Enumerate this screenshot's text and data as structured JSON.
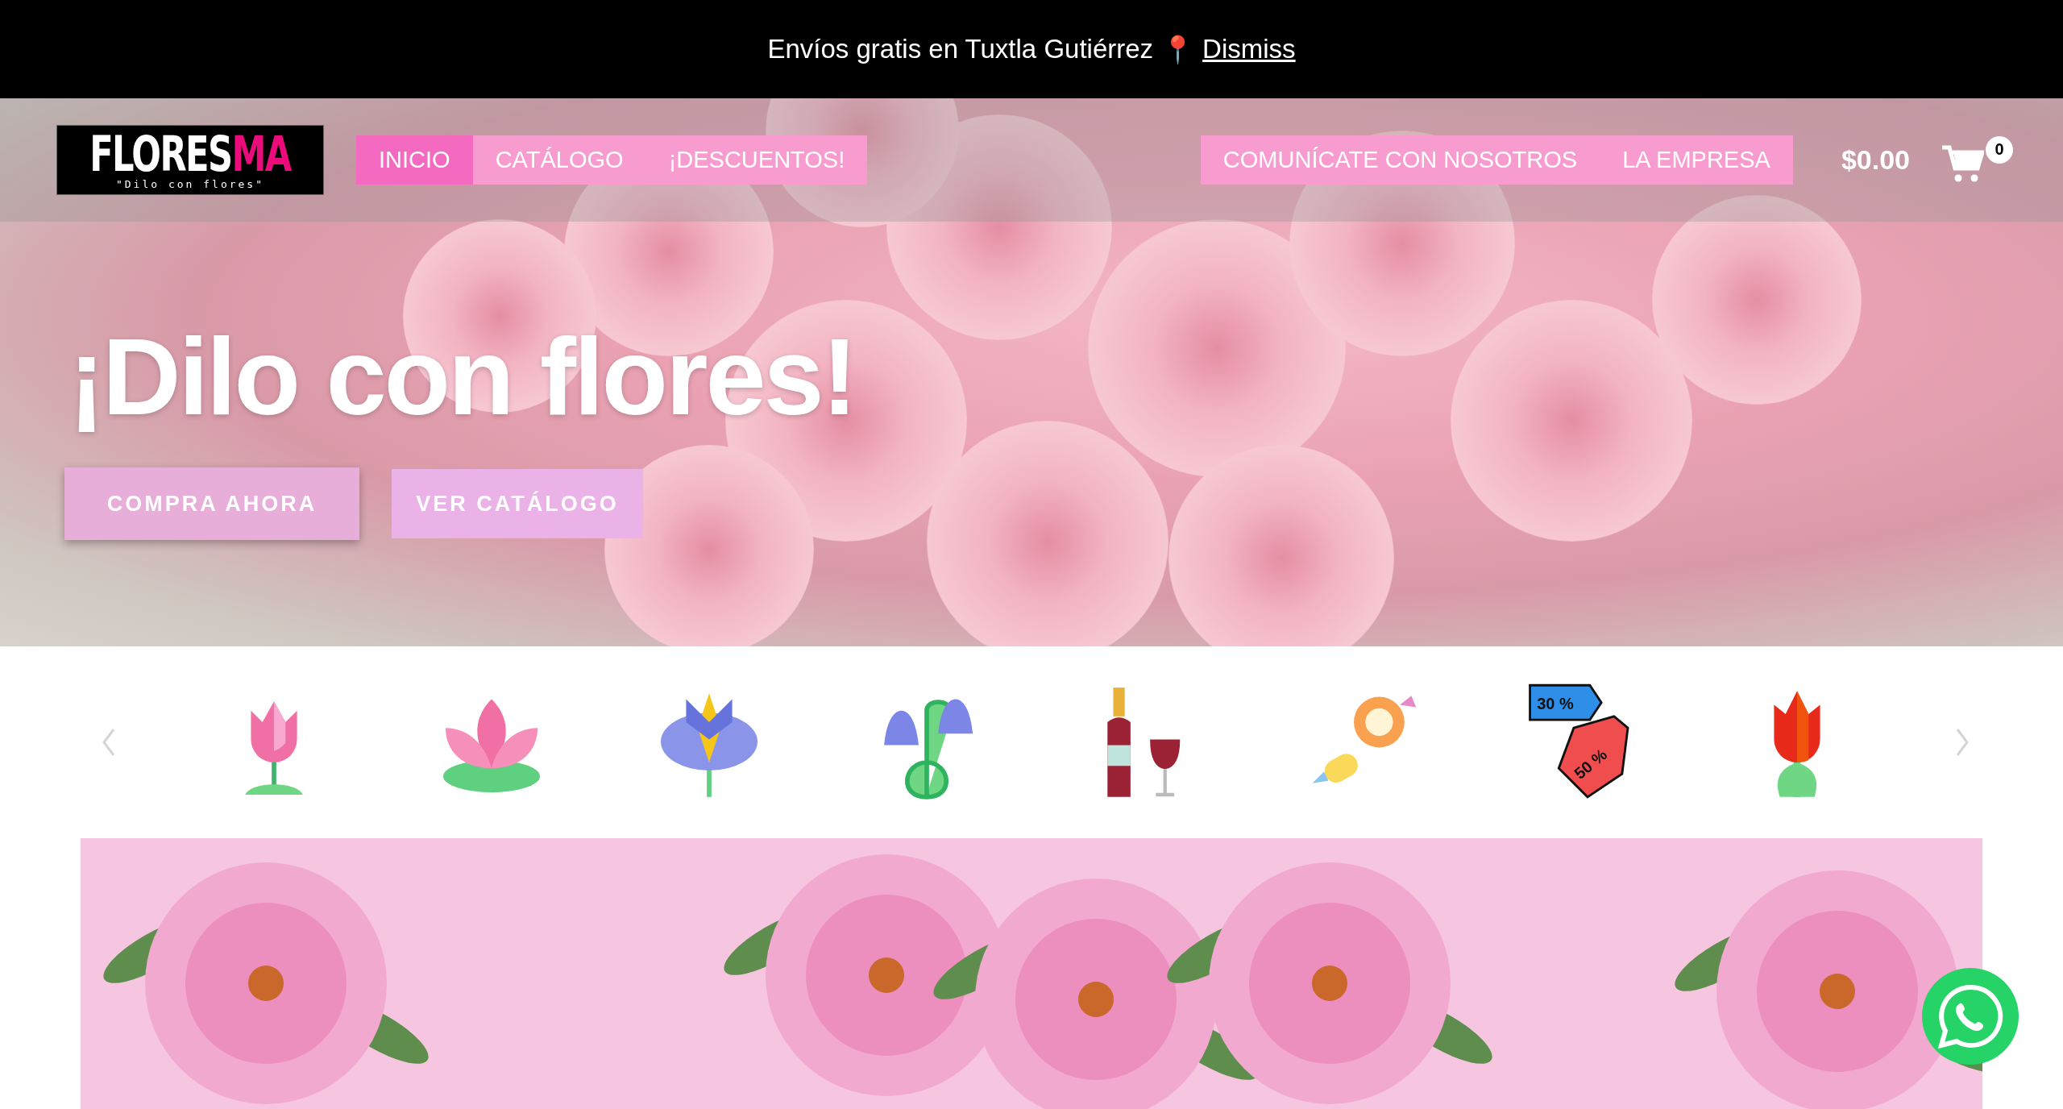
{
  "announcement": {
    "text": "Envíos gratis en Tuxtla Gutiérrez",
    "pin": "📍",
    "link": "Dismiss"
  },
  "logo": {
    "part_1": "FLORES",
    "part_2": "MA",
    "tagline": "\"Dilo con flores\""
  },
  "nav_left": [
    {
      "label": "INICIO",
      "selected": true
    },
    {
      "label": "CATÁLOGO",
      "selected": false
    },
    {
      "label": "¡DESCUENTOS!",
      "selected": false
    }
  ],
  "nav_right": [
    {
      "label": "COMUNÍCATE CON NOSOTROS",
      "selected": false
    },
    {
      "label": "LA EMPRESA",
      "selected": false
    }
  ],
  "cart": {
    "total": "$0.00",
    "count": "0"
  },
  "hero": {
    "title": "¡Dilo con flores!",
    "buttons": [
      "COMPRA AHORA",
      "VER CATÁLOGO"
    ]
  },
  "carousel": [
    {
      "kind": "tulip"
    },
    {
      "kind": "lotus"
    },
    {
      "kind": "iris"
    },
    {
      "kind": "bellflower"
    },
    {
      "kind": "wine"
    },
    {
      "kind": "candy"
    },
    {
      "kind": "tags",
      "labels": [
        "30 %",
        "50 %"
      ]
    },
    {
      "kind": "red-tulip"
    }
  ]
}
